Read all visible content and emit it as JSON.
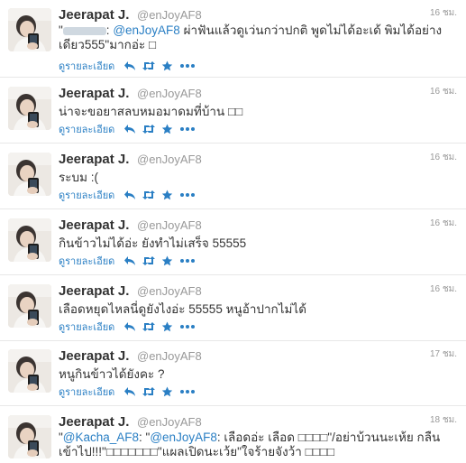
{
  "colors": {
    "link": "#2a7fc4",
    "muted": "#999999",
    "text": "#333333"
  },
  "timeline": {
    "tweets": [
      {
        "name": "Jeerapat J.",
        "handle": "@enJoyAF8",
        "time": "16 ชม.",
        "text_pre": "\"",
        "mention_blurred": "",
        "text_mid": ": ",
        "mention": "@enJoyAF8",
        "text_post": " ผ่าฟันแล้วดูเว่นกว่าปกติ พูดไม่ได้อะเด้ พิมได้อย่างเดียว555\"มากอ่ะ □",
        "details": "ดูรายละเอียด"
      },
      {
        "name": "Jeerapat J.",
        "handle": "@enJoyAF8",
        "time": "16 ชม.",
        "text": "น่าจะขอยาสลบหมอมาดมที่บ้าน □□",
        "details": "ดูรายละเอียด"
      },
      {
        "name": "Jeerapat J.",
        "handle": "@enJoyAF8",
        "time": "16 ชม.",
        "text": "ระบม :(",
        "details": "ดูรายละเอียด"
      },
      {
        "name": "Jeerapat J.",
        "handle": "@enJoyAF8",
        "time": "16 ชม.",
        "text": "กินข้าวไม่ได้อ่ะ ยังทำไม่เสร็จ 55555",
        "details": "ดูรายละเอียด"
      },
      {
        "name": "Jeerapat J.",
        "handle": "@enJoyAF8",
        "time": "16 ชม.",
        "text": "เลือดหยุดไหลนี่ดูยังไงอ่ะ 55555 หนูอ้าปากไม่ได้",
        "details": "ดูรายละเอียด"
      },
      {
        "name": "Jeerapat J.",
        "handle": "@enJoyAF8",
        "time": "17 ชม.",
        "text": "หนูกินข้าวได้ยังคะ ?",
        "details": "ดูรายละเอียด"
      },
      {
        "name": "Jeerapat J.",
        "handle": "@enJoyAF8",
        "time": "18 ชม.",
        "text_pre": "\"",
        "mention1": "@Kacha_AF8",
        "text_mid1": ": \"",
        "mention2": "@enJoyAF8",
        "text_post": ": เลือดอ่ะ เลือด □□□□\"/อย่าบ้วนนะเห้ย กลืนเข้าไป!!!\"□□□□□□□\"แผลเปิดนะเว้ย\"ใจร้ายจังว้า □□□□",
        "details": "ดูรายละเอียด"
      }
    ]
  }
}
